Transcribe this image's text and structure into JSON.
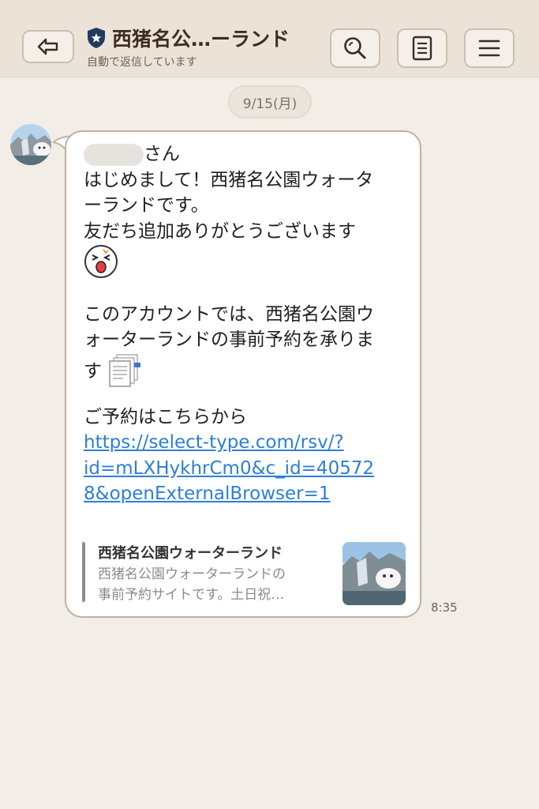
{
  "header": {
    "title": "西猪名公…ーランド",
    "subtitle": "自動で返信しています"
  },
  "chat": {
    "date": "9/15(月)",
    "message": {
      "name_suffix": "さん",
      "lines": [
        "はじめまして！西猪名公園ウォータ",
        "ーランドです。",
        "友だち追加ありがとうございます",
        "このアカウントでは、西猪名公園ウ",
        "ォーターランドの事前予約を承りま",
        "す",
        "ご予約はこちらから"
      ],
      "link_lines": [
        "https://select-type.com/rsv/?",
        "id=mLXHykhrCm0&c_id=40572",
        "8&openExternalBrowser=1"
      ]
    },
    "preview": {
      "title": "西猪名公園ウォーターランド",
      "description_line1": "西猪名公園ウォーターランドの",
      "description_line2": "事前予約サイトです。土日祝…"
    },
    "time": "8:35"
  },
  "icons": [
    "back-arrow-icon",
    "shield-star-icon",
    "search-icon",
    "notes-icon",
    "menu-icon",
    "emoji-face-icon",
    "documents-icon"
  ],
  "colors": {
    "background": "#f2ede6",
    "header": "#ebe3d8",
    "link": "#2d7fd5",
    "bubble_border": "#c2b09f"
  }
}
